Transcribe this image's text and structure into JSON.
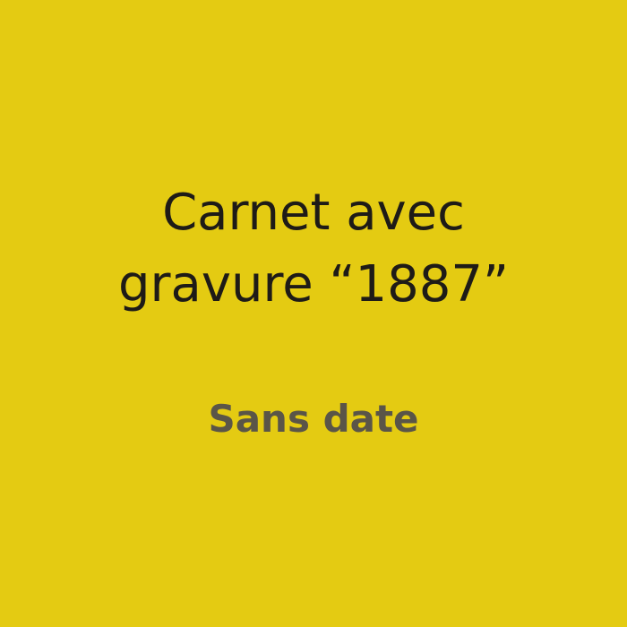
{
  "title_lines": [
    "Carnet avec",
    "gravure “1887”"
  ],
  "subtitle": "Sans date",
  "colors": {
    "background": "#e4cb12",
    "title": "#1e1b17",
    "subtitle": "#5a5548"
  }
}
